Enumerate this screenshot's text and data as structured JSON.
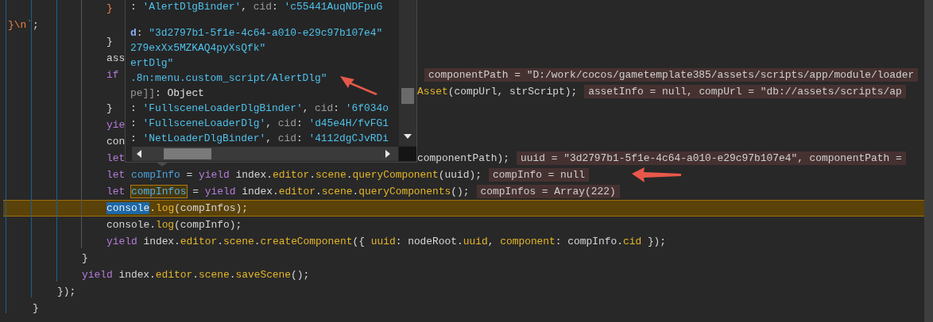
{
  "editor": {
    "lines": [
      {
        "children": [
          {
            "children": [
              {
                "children": [
                  {
                    "children": [
                      {
                        "tokens": [
                          {
                            "kind": "str",
                            "text": "}"
                          }
                        ]
                      }
                    ]
                  }
                ]
              }
            ]
          }
        ]
      },
      {
        "tokens": [
          {
            "kind": "str",
            "text": "}\\n`"
          },
          {
            "kind": "punct",
            "text": ";"
          }
        ]
      },
      {
        "children": [
          {
            "children": [
              {
                "children": [
                  {
                    "children": [
                      {
                        "tokens": [
                          {
                            "kind": "plain",
                            "text": "}"
                          }
                        ]
                      },
                      {
                        "tokens": [
                          {
                            "kind": "plain",
                            "text": "ass"
                          }
                        ]
                      },
                      {
                        "tokens": [
                          {
                            "kind": "kw",
                            "text": "if"
                          }
                        ],
                        "covered": true,
                        "hint": "componentPath = \"D:/work/cocos/gametemplate385/assets/scripts/app/module/loader"
                      },
                      {
                        "covered": true,
                        "tail": [
                          {
                            "kind": "fn",
                            "text": "Asset"
                          },
                          {
                            "kind": "plain",
                            "text": "(compUrl, strScript);"
                          }
                        ],
                        "hint": "assetInfo = null, compUrl = \"db://assets/scripts/ap"
                      },
                      {
                        "tokens": [
                          {
                            "kind": "plain",
                            "text": "}"
                          }
                        ]
                      },
                      {
                        "tokens": [
                          {
                            "kind": "kw",
                            "text": "yie"
                          }
                        ]
                      },
                      {
                        "tokens": [
                          {
                            "kind": "plain",
                            "text": "con"
                          }
                        ]
                      },
                      {
                        "tokens": [
                          {
                            "kind": "kw",
                            "text": "let"
                          }
                        ],
                        "covered": true,
                        "tail": [
                          {
                            "kind": "plain",
                            "text": "componentPath);"
                          }
                        ],
                        "hint": "uuid = \"3d2797b1-5f1e-4c64-a010-e29c97b107e4\", componentPath ="
                      },
                      {
                        "tokens": [
                          {
                            "kind": "kw",
                            "text": "let"
                          },
                          {
                            "kind": "var",
                            "text": " compInfo "
                          },
                          {
                            "kind": "plain",
                            "text": "= "
                          },
                          {
                            "kind": "kw",
                            "text": "yield"
                          },
                          {
                            "kind": "plain",
                            "text": " index."
                          },
                          {
                            "kind": "fn",
                            "text": "editor"
                          },
                          {
                            "kind": "plain",
                            "text": "."
                          },
                          {
                            "kind": "fn",
                            "text": "scene"
                          },
                          {
                            "kind": "plain",
                            "text": "."
                          },
                          {
                            "kind": "fn",
                            "text": "queryComponent"
                          },
                          {
                            "kind": "plain",
                            "text": "(uuid);"
                          }
                        ],
                        "hint": "compInfo = null"
                      },
                      {
                        "tokens": [
                          {
                            "kind": "kw",
                            "text": "let "
                          },
                          {
                            "kind": "boxed",
                            "text": "compInfos"
                          },
                          {
                            "kind": "plain",
                            "text": " = "
                          },
                          {
                            "kind": "kw",
                            "text": "yield"
                          },
                          {
                            "kind": "plain",
                            "text": " index."
                          },
                          {
                            "kind": "fn",
                            "text": "editor"
                          },
                          {
                            "kind": "plain",
                            "text": "."
                          },
                          {
                            "kind": "fn",
                            "text": "scene"
                          },
                          {
                            "kind": "plain",
                            "text": "."
                          },
                          {
                            "kind": "fn",
                            "text": "queryComponents"
                          },
                          {
                            "kind": "plain",
                            "text": "();"
                          }
                        ],
                        "hint": "compInfos = Array(222)"
                      },
                      {
                        "current": true,
                        "tokens": [
                          {
                            "kind": "sel",
                            "text": "console"
                          },
                          {
                            "kind": "plain",
                            "text": "."
                          },
                          {
                            "kind": "fn",
                            "text": "log"
                          },
                          {
                            "kind": "plain",
                            "text": "(compInfos);"
                          }
                        ]
                      },
                      {
                        "tokens": [
                          {
                            "kind": "plain",
                            "text": "console."
                          },
                          {
                            "kind": "fn",
                            "text": "log"
                          },
                          {
                            "kind": "plain",
                            "text": "(compInfo);"
                          }
                        ]
                      },
                      {
                        "tokens": [
                          {
                            "kind": "kw",
                            "text": "yield"
                          },
                          {
                            "kind": "plain",
                            "text": " index."
                          },
                          {
                            "kind": "fn",
                            "text": "editor"
                          },
                          {
                            "kind": "plain",
                            "text": "."
                          },
                          {
                            "kind": "fn",
                            "text": "scene"
                          },
                          {
                            "kind": "plain",
                            "text": "."
                          },
                          {
                            "kind": "fn",
                            "text": "createComponent"
                          },
                          {
                            "kind": "plain",
                            "text": "({ "
                          },
                          {
                            "kind": "fn",
                            "text": "uuid"
                          },
                          {
                            "kind": "plain",
                            "text": ": nodeRoot."
                          },
                          {
                            "kind": "fn",
                            "text": "uuid"
                          },
                          {
                            "kind": "plain",
                            "text": ", "
                          },
                          {
                            "kind": "fn",
                            "text": "component"
                          },
                          {
                            "kind": "plain",
                            "text": ": compInfo."
                          },
                          {
                            "kind": "fn",
                            "text": "cid"
                          },
                          {
                            "kind": "plain",
                            "text": " });"
                          }
                        ]
                      }
                    ]
                  },
                  {
                    "tokens": [
                      {
                        "kind": "plain",
                        "text": "}"
                      }
                    ]
                  },
                  {
                    "tokens": [
                      {
                        "kind": "kw",
                        "text": "yield"
                      },
                      {
                        "kind": "plain",
                        "text": " index."
                      },
                      {
                        "kind": "fn",
                        "text": "editor"
                      },
                      {
                        "kind": "plain",
                        "text": "."
                      },
                      {
                        "kind": "fn",
                        "text": "scene"
                      },
                      {
                        "kind": "plain",
                        "text": "."
                      },
                      {
                        "kind": "fn",
                        "text": "saveScene"
                      },
                      {
                        "kind": "plain",
                        "text": "();"
                      }
                    ]
                  }
                ]
              },
              {
                "tokens": [
                  {
                    "kind": "plain",
                    "text": "});"
                  }
                ]
              }
            ]
          },
          {
            "tokens": [
              {
                "kind": "plain",
                "text": "}"
              }
            ]
          }
        ]
      }
    ]
  },
  "tooltip": {
    "lines": [
      {
        "tokens": [
          {
            "kind": "punct",
            "text": ": "
          },
          {
            "kind": "str",
            "text": "'AlertDlgBinder'"
          },
          {
            "kind": "punct",
            "text": ", "
          },
          {
            "kind": "key",
            "text": "cid"
          },
          {
            "kind": "punct",
            "text": ": "
          },
          {
            "kind": "str",
            "text": "'c55441AuqNDFpuG"
          }
        ]
      },
      {
        "tokens": [
          {
            "kind": "prop",
            "text": "d"
          },
          {
            "kind": "punct",
            "text": ": "
          },
          {
            "kind": "str",
            "text": "\"3d2797b1-5f1e-4c64-a010-e29c97b107e4\""
          }
        ]
      },
      {
        "tokens": [
          {
            "kind": "str",
            "text": "279exXx5MZKAQ4pyXsQfk\""
          }
        ]
      },
      {
        "tokens": [
          {
            "kind": "str",
            "text": "ertDlg\""
          }
        ]
      },
      {
        "tokens": [
          {
            "kind": "str",
            "text": ".8n:menu.custom_script/AlertDlg\""
          }
        ]
      },
      {
        "tokens": [
          {
            "kind": "key",
            "text": "pe]]"
          },
          {
            "kind": "punct",
            "text": ": "
          },
          {
            "kind": "obj",
            "text": "Object"
          }
        ]
      },
      {
        "tokens": [
          {
            "kind": "punct",
            "text": ": "
          },
          {
            "kind": "str",
            "text": "'FullsceneLoaderDlgBinder'"
          },
          {
            "kind": "punct",
            "text": ", "
          },
          {
            "kind": "key",
            "text": "cid"
          },
          {
            "kind": "punct",
            "text": ": "
          },
          {
            "kind": "str",
            "text": "'6f034o"
          }
        ]
      },
      {
        "tokens": [
          {
            "kind": "punct",
            "text": ": "
          },
          {
            "kind": "str",
            "text": "'FullsceneLoaderDlg'"
          },
          {
            "kind": "punct",
            "text": ", "
          },
          {
            "kind": "key",
            "text": "cid"
          },
          {
            "kind": "punct",
            "text": ": "
          },
          {
            "kind": "str",
            "text": "'d45e4H/fvFG1"
          }
        ]
      },
      {
        "tokens": [
          {
            "kind": "punct",
            "text": ": "
          },
          {
            "kind": "str",
            "text": "'NetLoaderDlgBinder'"
          },
          {
            "kind": "punct",
            "text": ", "
          },
          {
            "kind": "key",
            "text": "cid"
          },
          {
            "kind": "punct",
            "text": ": "
          },
          {
            "kind": "str",
            "text": "'4112dgCJvRDi"
          }
        ]
      }
    ]
  }
}
